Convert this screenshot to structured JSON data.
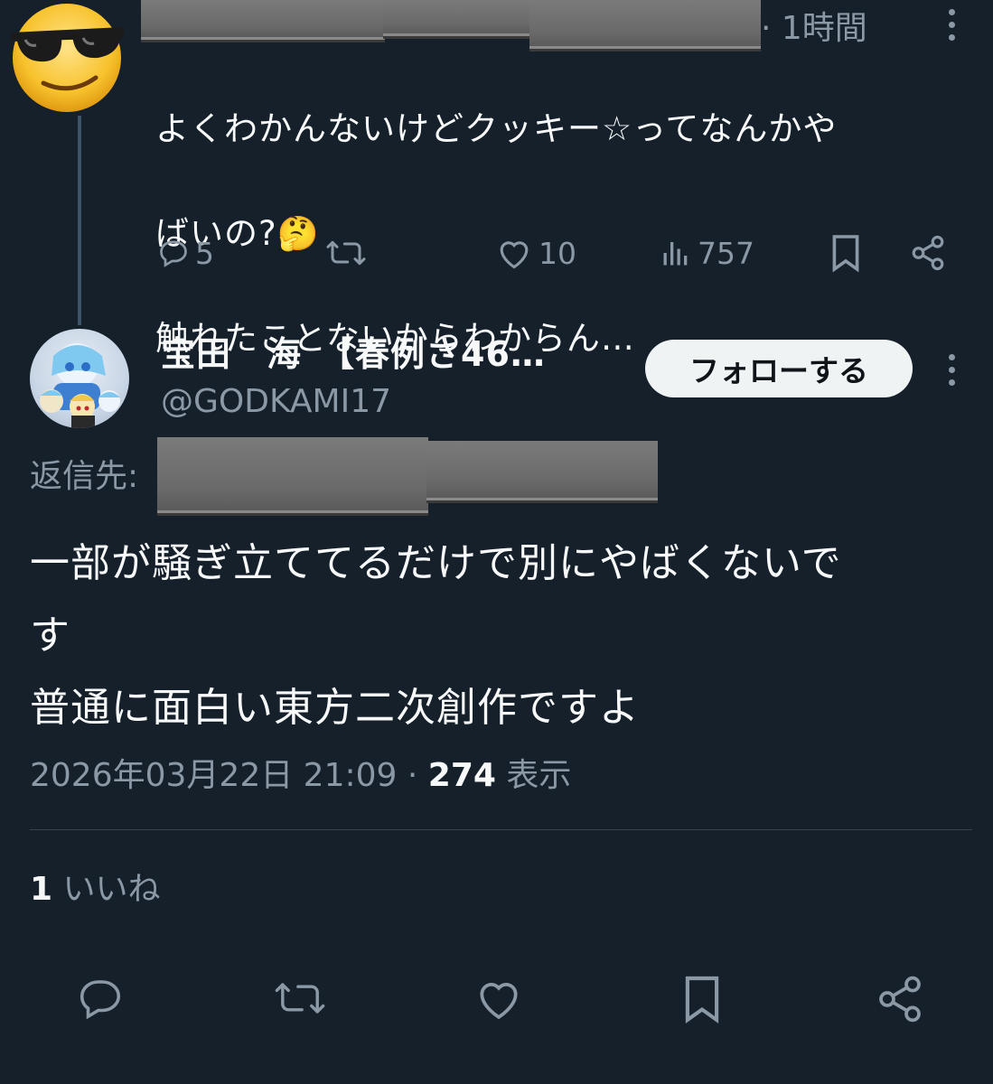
{
  "colors": {
    "background": "#15202b",
    "text_primary": "#f7f9f9",
    "text_secondary": "#8b98a5",
    "divider": "#38444d",
    "thread_line": "#3d5466",
    "follow_bg": "#eff3f4"
  },
  "parent_tweet": {
    "avatar_icon": "sunglasses-emoji-avatar",
    "time": "· 1時間",
    "text_lines": [
      "よくわかんないけどクッキー☆ってなんかや",
      "ばいの?🤔",
      "触れたことないからわからん…"
    ],
    "actions": {
      "reply_count": "5",
      "retweet_count": "",
      "like_count": "10",
      "view_count": "757"
    }
  },
  "reply_tweet": {
    "display_name": "宝田　海　【春例さ46…",
    "handle": "@GODKAMI17",
    "follow_label": "フォローする",
    "reply_to_label": "返信先:",
    "text_lines": [
      "一部が騒ぎ立ててるだけで別にやばくないで",
      "す",
      "普通に面白い東方二次創作ですよ"
    ],
    "timestamp": "2026年03月22日 21:09",
    "separator": " · ",
    "views_count": "274",
    "views_label": " 表示",
    "likes_count": "1",
    "likes_label": " いいね"
  },
  "bottom_actions": [
    "reply-icon",
    "retweet-icon",
    "like-icon",
    "bookmark-icon",
    "share-icon"
  ]
}
